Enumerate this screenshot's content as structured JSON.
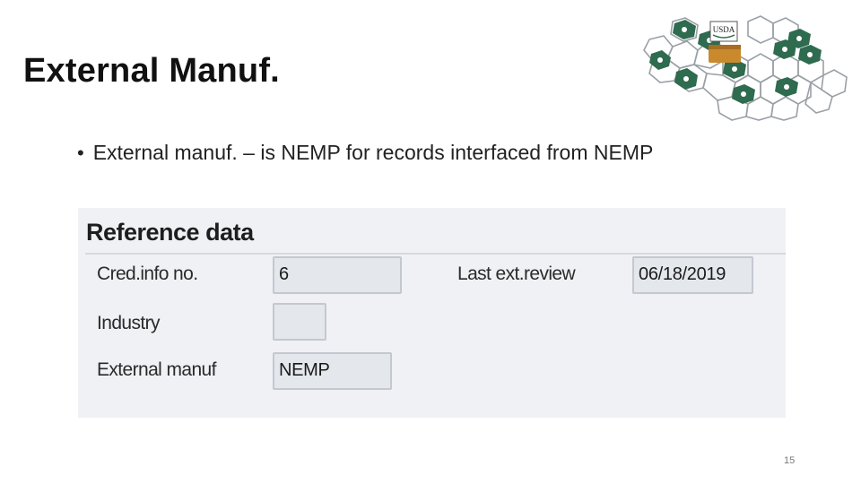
{
  "slide": {
    "title": "External Manuf.",
    "bullet": "External manuf. – is NEMP for records interfaced from NEMP",
    "page_number": "15"
  },
  "logo": {
    "text": "USDA",
    "accent_color": "#2e6b4f"
  },
  "reference_data": {
    "section_title": "Reference data",
    "fields": {
      "cred_info_no": {
        "label": "Cred.info no.",
        "value": "6"
      },
      "last_ext_review": {
        "label": "Last ext.review",
        "value": "06/18/2019"
      },
      "industry": {
        "label": "Industry",
        "value": ""
      },
      "external_manuf": {
        "label": "External manuf",
        "value": "NEMP"
      }
    }
  }
}
